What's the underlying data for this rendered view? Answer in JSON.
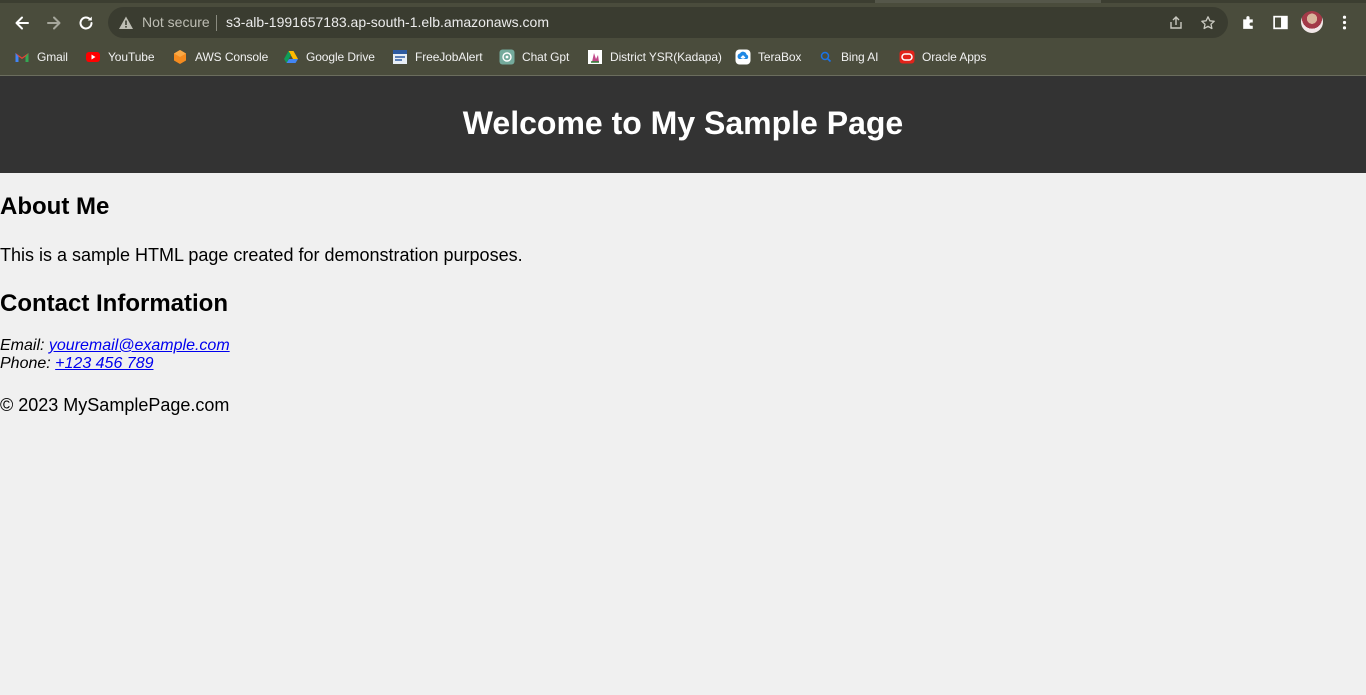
{
  "browser": {
    "security_label": "Not secure",
    "url": "s3-alb-1991657183.ap-south-1.elb.amazonaws.com",
    "bookmarks": [
      {
        "label": "Gmail",
        "icon": "gmail-icon"
      },
      {
        "label": "YouTube",
        "icon": "youtube-icon"
      },
      {
        "label": "AWS Console",
        "icon": "aws-icon"
      },
      {
        "label": "Google Drive",
        "icon": "google-drive-icon"
      },
      {
        "label": "FreeJobAlert",
        "icon": "freejobalert-icon"
      },
      {
        "label": "Chat Gpt",
        "icon": "chatgpt-icon"
      },
      {
        "label": "District YSR(Kadapa)",
        "icon": "district-icon"
      },
      {
        "label": "TeraBox",
        "icon": "terabox-icon"
      },
      {
        "label": "Bing AI",
        "icon": "bing-icon"
      },
      {
        "label": "Oracle Apps",
        "icon": "oracle-icon"
      }
    ]
  },
  "page": {
    "title": "Welcome to My Sample Page",
    "about": {
      "heading": "About Me",
      "text": "This is a sample HTML page created for demonstration purposes."
    },
    "contact": {
      "heading": "Contact Information",
      "email_label": "Email:",
      "email": "youremail@example.com",
      "phone_label": "Phone:",
      "phone": "+123 456 789"
    },
    "footer": "© 2023 MySamplePage.com"
  },
  "colors": {
    "chrome_bg": "#4a4c3c",
    "header_bg": "#333333",
    "page_bg": "#f0f0f0",
    "link": "#0000ee"
  }
}
